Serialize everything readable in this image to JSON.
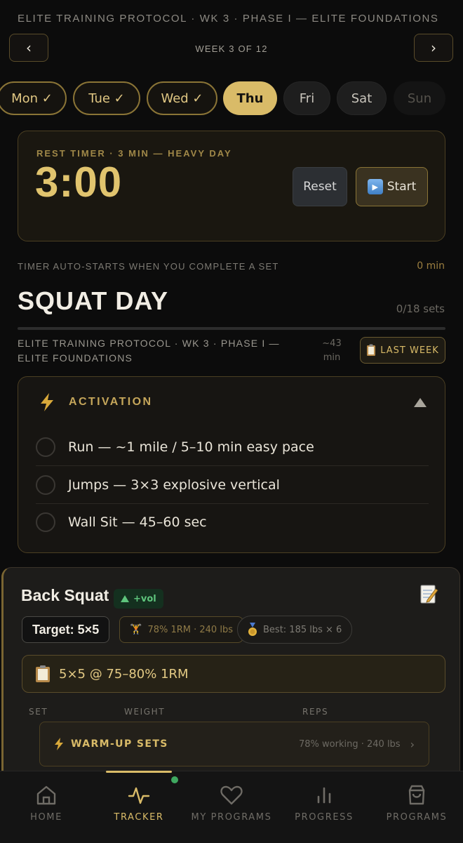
{
  "header": {
    "protocol_title": "ELITE TRAINING PROTOCOL · WK 3 · PHASE I — ELITE FOUNDATIONS",
    "week_label": "WEEK 3 OF 12",
    "prev_glyph": "‹",
    "next_glyph": "›"
  },
  "days": [
    {
      "label": "Mon ✓",
      "state": "done"
    },
    {
      "label": "Tue ✓",
      "state": "done"
    },
    {
      "label": "Wed ✓",
      "state": "done"
    },
    {
      "label": "Thu",
      "state": "active"
    },
    {
      "label": "Fri",
      "state": "future"
    },
    {
      "label": "Sat",
      "state": "future"
    },
    {
      "label": "Sun",
      "state": "rest"
    }
  ],
  "timer": {
    "label": "REST TIMER · 3 MIN — HEAVY DAY",
    "value": "3:00",
    "reset_label": "Reset",
    "start_label": "Start",
    "auto_note": "TIMER AUTO-STARTS WHEN YOU COMPLETE A SET",
    "elapsed": "0 min"
  },
  "session": {
    "title": "SQUAT DAY",
    "sets_done": "0/18 sets",
    "progress": 0,
    "protocol": "ELITE TRAINING PROTOCOL · WK 3 · PHASE I — ELITE FOUNDATIONS",
    "duration": "~43 min",
    "last_week_label": "LAST WEEK"
  },
  "activation": {
    "title": "ACTIVATION",
    "items": [
      "Run — ~1 mile / 5–10 min easy pace",
      "Jumps — 3×3 explosive vertical",
      "Wall Sit — 45–60 sec"
    ]
  },
  "exercise": {
    "name": "Back Squat",
    "badge": "+vol",
    "target": "Target: 5×5",
    "intensity": "78% 1RM · 240 lbs",
    "best": "Best: 185 lbs × 6",
    "scheme": "5×5 @ 75–80% 1RM",
    "columns": {
      "set": "SET",
      "weight": "WEIGHT",
      "reps": "REPS"
    },
    "warmup_label": "WARM-UP SETS",
    "warmup_info": "78% working · 240 lbs"
  },
  "nav": [
    {
      "label": "HOME",
      "icon": "home-icon"
    },
    {
      "label": "TRACKER",
      "icon": "pulse-icon",
      "active": true
    },
    {
      "label": "MY PROGRAMS",
      "icon": "heart-icon"
    },
    {
      "label": "PROGRESS",
      "icon": "bar-chart-icon"
    },
    {
      "label": "PROGRAMS",
      "icon": "shopping-bag-icon"
    }
  ],
  "colors": {
    "accent": "#d9bb68",
    "background": "#0c0c0c",
    "badge_green": "#5ec47c"
  }
}
